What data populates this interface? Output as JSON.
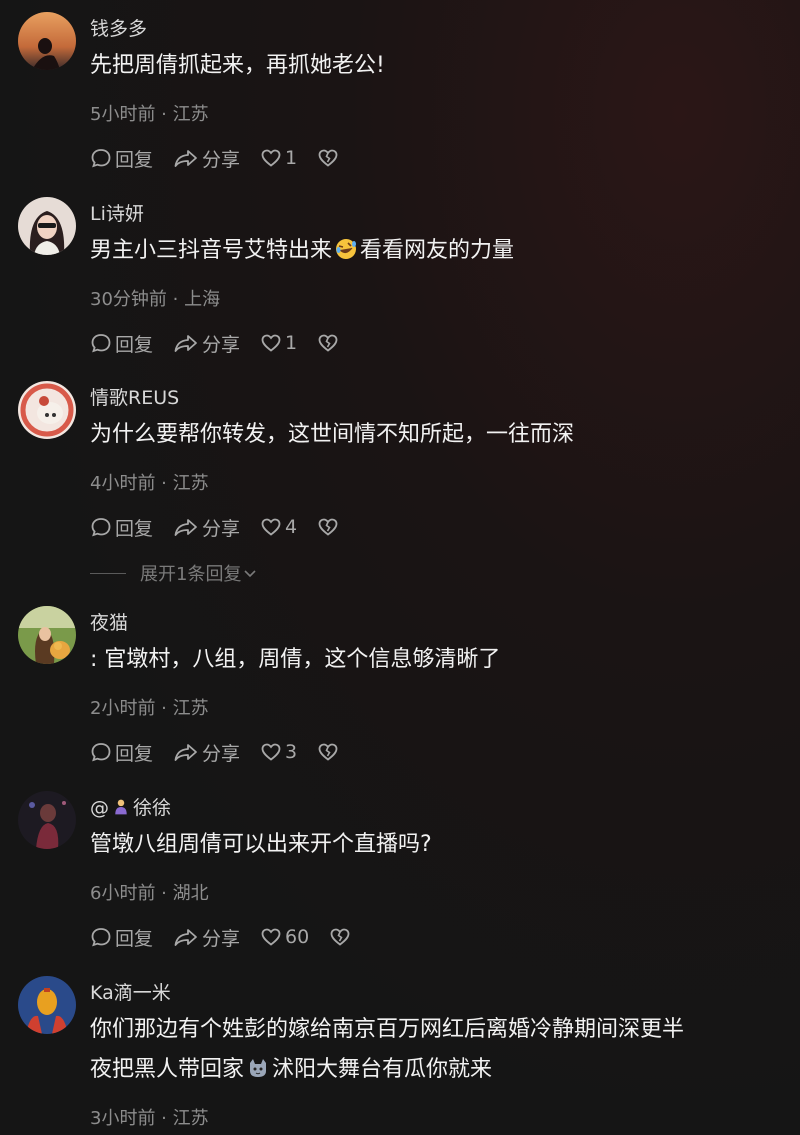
{
  "comments": [
    {
      "username": "钱多多",
      "text": "先把周倩抓起来，再抓她老公!",
      "meta": "5小时前 · 江苏",
      "reply": "回复",
      "share": "分享",
      "likes": "1"
    },
    {
      "username": "Li诗妍",
      "text_a": "男主小三抖音号艾特出来",
      "text_b": "看看网友的力量",
      "meta": "30分钟前 · 上海",
      "reply": "回复",
      "share": "分享",
      "likes": "1"
    },
    {
      "username": "情歌REUS",
      "text": "为什么要帮你转发，这世间情不知所起，一往而深",
      "meta": "4小时前 · 江苏",
      "reply": "回复",
      "share": "分享",
      "likes": "4"
    },
    {
      "username": "夜猫",
      "text": ": 官墩村，八组，周倩，这个信息够清晰了",
      "meta": "2小时前 · 江苏",
      "reply": "回复",
      "share": "分享",
      "likes": "3"
    },
    {
      "username_prefix": "@",
      "username": "徐徐",
      "text": "管墩八组周倩可以出来开个直播吗?",
      "meta": "6小时前 · 湖北",
      "reply": "回复",
      "share": "分享",
      "likes": "60"
    },
    {
      "username": "Ka滴一米",
      "text_a": "你们那边有个姓彭的嫁给南京百万网红后离婚冷静期间深更半",
      "text_b": "夜把黑人带回家",
      "text_c": "沭阳大舞台有瓜你就来",
      "meta": "3小时前 · 江苏"
    }
  ],
  "expand_replies": "展开1条回复",
  "icons": {
    "reply": "comment-bubble-icon",
    "share": "share-arrow-icon",
    "like": "heart-icon",
    "dislike": "broken-heart-icon",
    "expand": "chevron-down-icon"
  }
}
